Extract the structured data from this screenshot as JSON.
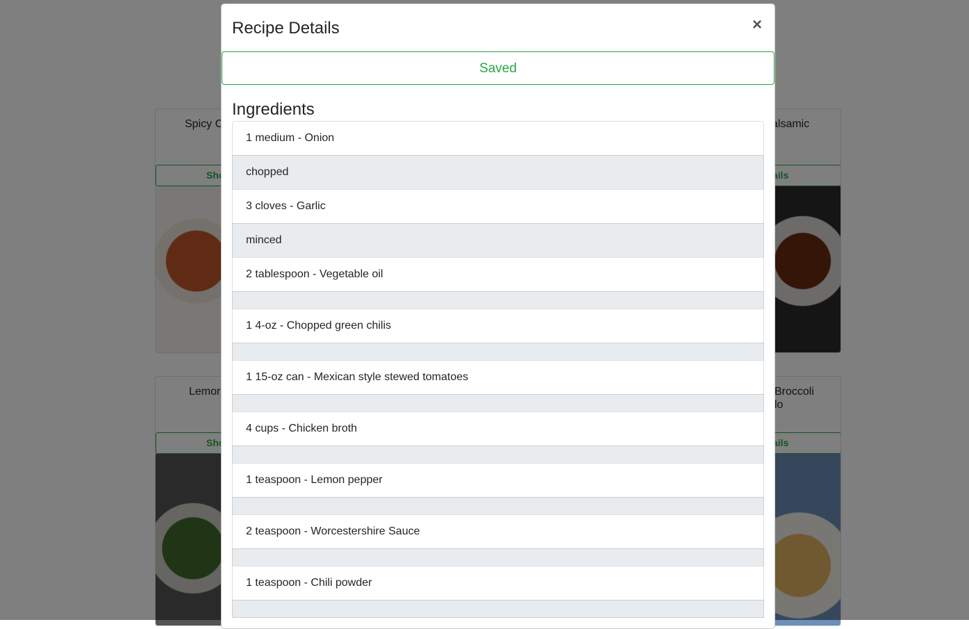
{
  "background": {
    "cards": [
      {
        "title": "Spicy C",
        "button": "Sho"
      },
      {
        "title": "alsamic",
        "button": "ails"
      },
      {
        "title": "Lemor",
        "button": "Sho"
      },
      {
        "title": "Broccoli\nlo",
        "button": "ails"
      }
    ]
  },
  "modal": {
    "title": "Recipe Details",
    "close_label": "×",
    "saved_label": "Saved",
    "section_title": "Ingredients",
    "ingredients": [
      {
        "item": "1 medium - Onion",
        "note": "chopped"
      },
      {
        "item": "3 cloves - Garlic",
        "note": "minced"
      },
      {
        "item": "2 tablespoon - Vegetable oil",
        "note": ""
      },
      {
        "item": "1 4-oz - Chopped green chilis",
        "note": ""
      },
      {
        "item": "1 15-oz can - Mexican style stewed tomatoes",
        "note": ""
      },
      {
        "item": "4 cups - Chicken broth",
        "note": ""
      },
      {
        "item": "1 teaspoon - Lemon pepper",
        "note": ""
      },
      {
        "item": "2 teaspoon - Worcestershire Sauce",
        "note": ""
      },
      {
        "item": "1 teaspoon - Chili powder",
        "note": ""
      }
    ]
  },
  "colors": {
    "accent": "#28a745",
    "note_bg": "#e9ecef",
    "backdrop": "rgba(0,0,0,0.5)"
  }
}
